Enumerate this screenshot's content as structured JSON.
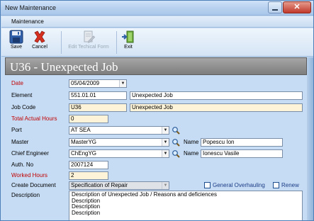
{
  "window": {
    "title": "New Maintenance"
  },
  "menubar": {
    "label": "Maintenance"
  },
  "toolbar": {
    "save_label": "Save",
    "cancel_label": "Cancel",
    "edit_form_label": "Edit Techical Form",
    "exit_label": "Exit"
  },
  "header": {
    "title": "U36 - Unexpected Job"
  },
  "form": {
    "date_label": "Date",
    "date_value": "05/04/2009",
    "element_label": "Element",
    "element_code": "551.01.01",
    "element_name": "Unexpected Job",
    "jobcode_label": "Job Code",
    "jobcode_code": "U36",
    "jobcode_name": "Unexpected Job",
    "total_hours_label": "Total Actual Hours",
    "total_hours_value": "0",
    "port_label": "Port",
    "port_value": "AT SEA",
    "master_label": "Master",
    "master_value": "MasterYG",
    "master_name_label": "Name",
    "master_name_value": "Popescu Ion",
    "chief_label": "Chief Engineer",
    "chief_value": "ChEngYG",
    "chief_name_label": "Name",
    "chief_name_value": "Ionescu Vasile",
    "auth_label": "Auth. No",
    "auth_value": "2007124",
    "worked_label": "Worked Hours",
    "worked_value": "2",
    "create_doc_label": "Create Document",
    "create_doc_value": "Specification of Repair",
    "general_overhauling_label": "General Overhauling",
    "renew_label": "Renew",
    "description_label": "Description",
    "description_lines": [
      "Description of Unexpected Job / Reasons and deficiences",
      "Description",
      "Description",
      "Description"
    ]
  },
  "colors": {
    "required_label": "#c00000",
    "header_bar": "#8a8a8a",
    "window_bg": "#c6dcf4",
    "checkbox_label": "#1c3c86"
  },
  "icons": {
    "save": "floppy-disk-icon",
    "cancel": "red-x-icon",
    "edit_form": "document-edit-icon",
    "exit": "exit-door-icon",
    "lookup": "magnifier-icon"
  }
}
